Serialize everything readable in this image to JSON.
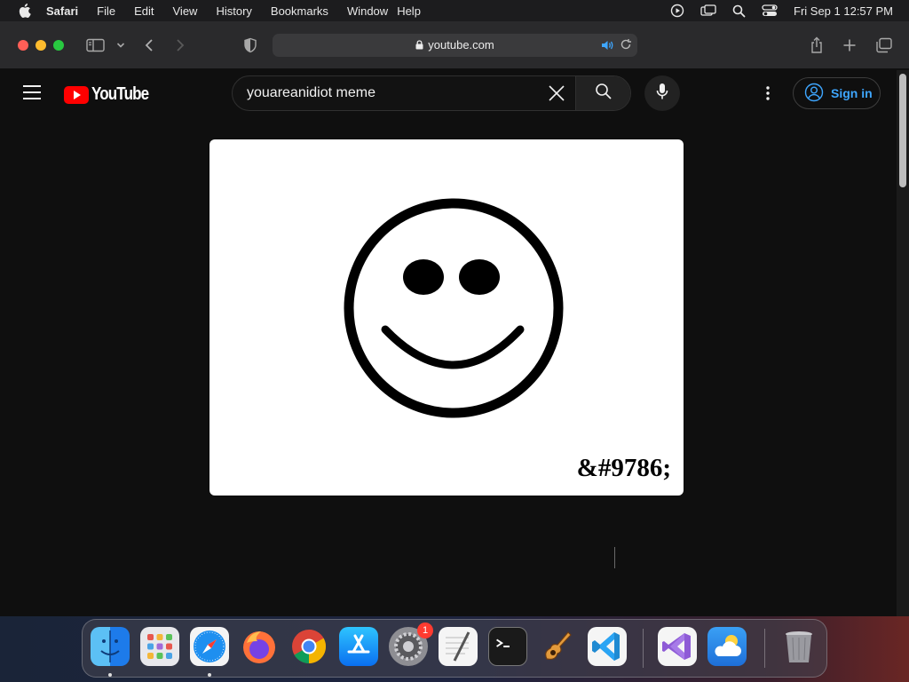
{
  "menubar": {
    "app_name": "Safari",
    "items": [
      "File",
      "Edit",
      "View",
      "History",
      "Bookmarks",
      "Window",
      "Help"
    ],
    "clock": "Fri Sep 1  12:57 PM"
  },
  "safari": {
    "url": "youtube.com"
  },
  "youtube": {
    "logo_text": "YouTube",
    "search_value": "youareanidiot meme",
    "sign_in_label": "Sign in",
    "colors": {
      "accent": "#3ea6ff",
      "brand": "#ff0000",
      "background": "#0f0f0f"
    }
  },
  "video": {
    "caption": "&#9786;"
  },
  "dock": {
    "apps": [
      {
        "name": "finder",
        "running": true
      },
      {
        "name": "launchpad",
        "running": false
      },
      {
        "name": "safari",
        "running": true
      },
      {
        "name": "firefox",
        "running": false
      },
      {
        "name": "chrome",
        "running": false
      },
      {
        "name": "app-store",
        "running": false
      },
      {
        "name": "system-settings",
        "running": false,
        "badge": "1"
      },
      {
        "name": "textedit",
        "running": false
      },
      {
        "name": "terminal",
        "running": false
      },
      {
        "name": "garageband",
        "running": false
      },
      {
        "name": "vscode",
        "running": false
      },
      {
        "name": "visual-studio",
        "running": false
      },
      {
        "name": "weather",
        "running": false
      },
      {
        "name": "trash",
        "running": false
      }
    ]
  }
}
